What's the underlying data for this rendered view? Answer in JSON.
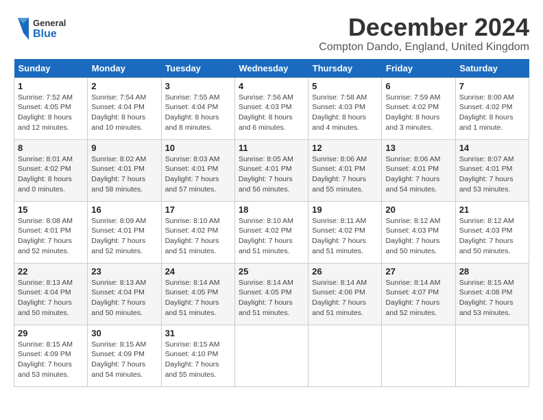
{
  "header": {
    "logo_line1": "General",
    "logo_line2": "Blue",
    "month_year": "December 2024",
    "location": "Compton Dando, England, United Kingdom"
  },
  "weekdays": [
    "Sunday",
    "Monday",
    "Tuesday",
    "Wednesday",
    "Thursday",
    "Friday",
    "Saturday"
  ],
  "weeks": [
    [
      {
        "day": "1",
        "info": "Sunrise: 7:52 AM\nSunset: 4:05 PM\nDaylight: 8 hours and 12 minutes."
      },
      {
        "day": "2",
        "info": "Sunrise: 7:54 AM\nSunset: 4:04 PM\nDaylight: 8 hours and 10 minutes."
      },
      {
        "day": "3",
        "info": "Sunrise: 7:55 AM\nSunset: 4:04 PM\nDaylight: 8 hours and 8 minutes."
      },
      {
        "day": "4",
        "info": "Sunrise: 7:56 AM\nSunset: 4:03 PM\nDaylight: 8 hours and 6 minutes."
      },
      {
        "day": "5",
        "info": "Sunrise: 7:58 AM\nSunset: 4:03 PM\nDaylight: 8 hours and 4 minutes."
      },
      {
        "day": "6",
        "info": "Sunrise: 7:59 AM\nSunset: 4:02 PM\nDaylight: 8 hours and 3 minutes."
      },
      {
        "day": "7",
        "info": "Sunrise: 8:00 AM\nSunset: 4:02 PM\nDaylight: 8 hours and 1 minute."
      }
    ],
    [
      {
        "day": "8",
        "info": "Sunrise: 8:01 AM\nSunset: 4:02 PM\nDaylight: 8 hours and 0 minutes."
      },
      {
        "day": "9",
        "info": "Sunrise: 8:02 AM\nSunset: 4:01 PM\nDaylight: 7 hours and 58 minutes."
      },
      {
        "day": "10",
        "info": "Sunrise: 8:03 AM\nSunset: 4:01 PM\nDaylight: 7 hours and 57 minutes."
      },
      {
        "day": "11",
        "info": "Sunrise: 8:05 AM\nSunset: 4:01 PM\nDaylight: 7 hours and 56 minutes."
      },
      {
        "day": "12",
        "info": "Sunrise: 8:06 AM\nSunset: 4:01 PM\nDaylight: 7 hours and 55 minutes."
      },
      {
        "day": "13",
        "info": "Sunrise: 8:06 AM\nSunset: 4:01 PM\nDaylight: 7 hours and 54 minutes."
      },
      {
        "day": "14",
        "info": "Sunrise: 8:07 AM\nSunset: 4:01 PM\nDaylight: 7 hours and 53 minutes."
      }
    ],
    [
      {
        "day": "15",
        "info": "Sunrise: 8:08 AM\nSunset: 4:01 PM\nDaylight: 7 hours and 52 minutes."
      },
      {
        "day": "16",
        "info": "Sunrise: 8:09 AM\nSunset: 4:01 PM\nDaylight: 7 hours and 52 minutes."
      },
      {
        "day": "17",
        "info": "Sunrise: 8:10 AM\nSunset: 4:02 PM\nDaylight: 7 hours and 51 minutes."
      },
      {
        "day": "18",
        "info": "Sunrise: 8:10 AM\nSunset: 4:02 PM\nDaylight: 7 hours and 51 minutes."
      },
      {
        "day": "19",
        "info": "Sunrise: 8:11 AM\nSunset: 4:02 PM\nDaylight: 7 hours and 51 minutes."
      },
      {
        "day": "20",
        "info": "Sunrise: 8:12 AM\nSunset: 4:03 PM\nDaylight: 7 hours and 50 minutes."
      },
      {
        "day": "21",
        "info": "Sunrise: 8:12 AM\nSunset: 4:03 PM\nDaylight: 7 hours and 50 minutes."
      }
    ],
    [
      {
        "day": "22",
        "info": "Sunrise: 8:13 AM\nSunset: 4:04 PM\nDaylight: 7 hours and 50 minutes."
      },
      {
        "day": "23",
        "info": "Sunrise: 8:13 AM\nSunset: 4:04 PM\nDaylight: 7 hours and 50 minutes."
      },
      {
        "day": "24",
        "info": "Sunrise: 8:14 AM\nSunset: 4:05 PM\nDaylight: 7 hours and 51 minutes."
      },
      {
        "day": "25",
        "info": "Sunrise: 8:14 AM\nSunset: 4:05 PM\nDaylight: 7 hours and 51 minutes."
      },
      {
        "day": "26",
        "info": "Sunrise: 8:14 AM\nSunset: 4:06 PM\nDaylight: 7 hours and 51 minutes."
      },
      {
        "day": "27",
        "info": "Sunrise: 8:14 AM\nSunset: 4:07 PM\nDaylight: 7 hours and 52 minutes."
      },
      {
        "day": "28",
        "info": "Sunrise: 8:15 AM\nSunset: 4:08 PM\nDaylight: 7 hours and 53 minutes."
      }
    ],
    [
      {
        "day": "29",
        "info": "Sunrise: 8:15 AM\nSunset: 4:09 PM\nDaylight: 7 hours and 53 minutes."
      },
      {
        "day": "30",
        "info": "Sunrise: 8:15 AM\nSunset: 4:09 PM\nDaylight: 7 hours and 54 minutes."
      },
      {
        "day": "31",
        "info": "Sunrise: 8:15 AM\nSunset: 4:10 PM\nDaylight: 7 hours and 55 minutes."
      },
      null,
      null,
      null,
      null
    ]
  ]
}
